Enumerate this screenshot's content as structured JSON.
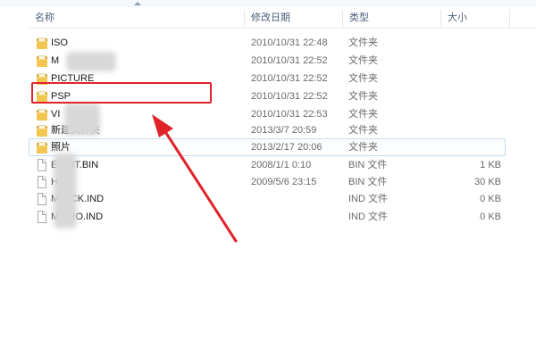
{
  "columns": {
    "name": "名称",
    "date": "修改日期",
    "type": "类型",
    "size": "大小"
  },
  "rows": [
    {
      "name": "ISO",
      "date": "2010/10/31 22:48",
      "type": "文件夹",
      "size": "",
      "icon": "folder-icon"
    },
    {
      "name": "M",
      "date": "2010/10/31 22:52",
      "type": "文件夹",
      "size": "",
      "icon": "folder-icon"
    },
    {
      "name": "PICTURE",
      "date": "2010/10/31 22:52",
      "type": "文件夹",
      "size": "",
      "icon": "folder-icon"
    },
    {
      "name": "PSP",
      "date": "2010/10/31 22:52",
      "type": "文件夹",
      "size": "",
      "icon": "folder-icon"
    },
    {
      "name": "VI",
      "date": "2010/10/31 22:53",
      "type": "文件夹",
      "size": "",
      "icon": "folder-icon"
    },
    {
      "name": "新建文件夹",
      "date": "2013/3/7 20:59",
      "type": "文件夹",
      "size": "",
      "icon": "folder-icon"
    },
    {
      "name": "照片",
      "date": "2013/2/17 20:06",
      "type": "文件夹",
      "size": "",
      "icon": "folder-icon"
    },
    {
      "name": "E  UNT.BIN",
      "date": "2008/1/1 0:10",
      "type": "BIN 文件",
      "size": "1 KB",
      "icon": "file-icon"
    },
    {
      "name": "H",
      "date": "2009/5/6 23:15",
      "type": "BIN 文件",
      "size": "30 KB",
      "icon": "file-icon"
    },
    {
      "name": "M    TICK.IND",
      "date": "",
      "type": "IND 文件",
      "size": "0 KB",
      "icon": "file-icon"
    },
    {
      "name": "M    PRO.IND",
      "date": "",
      "type": "IND 文件",
      "size": "0 KB",
      "icon": "file-icon"
    }
  ],
  "colors": {
    "highlight": "#e0242a",
    "selection_border": "#c7dcf3",
    "folder": "#f2c650"
  }
}
